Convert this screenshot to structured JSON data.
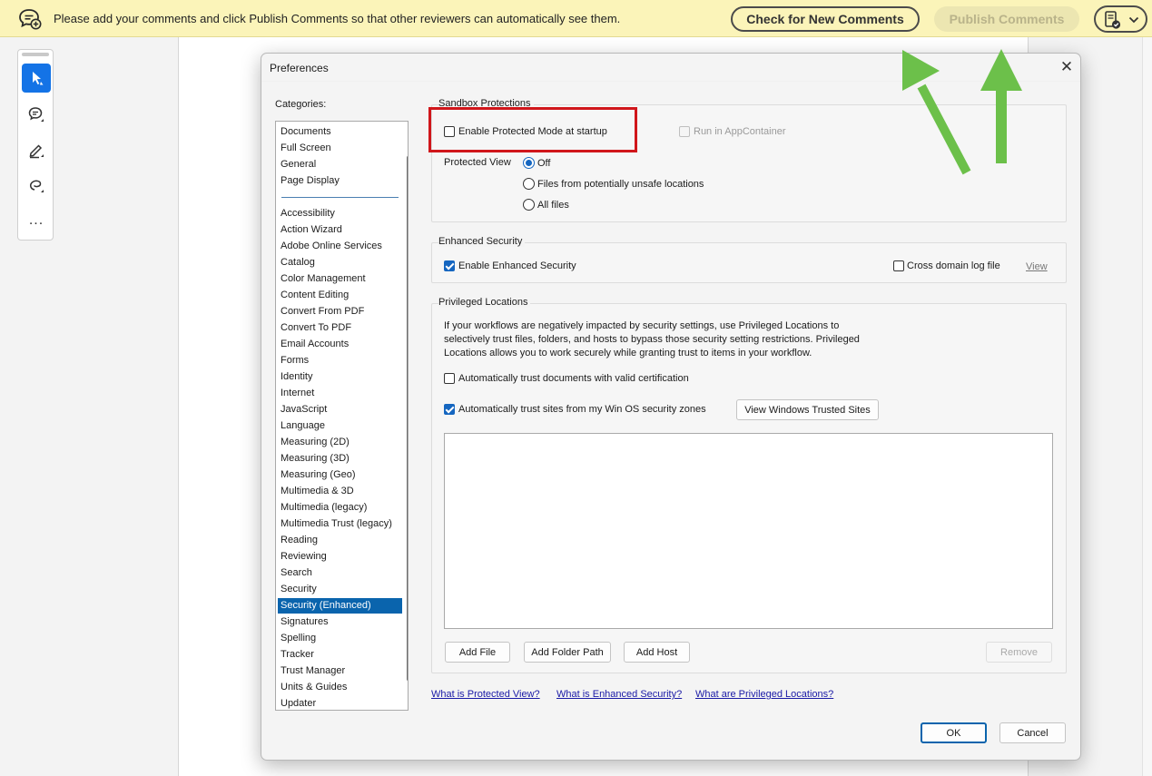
{
  "comment_bar": {
    "message": "Please add your comments and click Publish Comments so that other reviewers can automatically see them.",
    "check_button": "Check for New Comments",
    "publish_button": "Publish Comments"
  },
  "tool_rail": {
    "more_label": "..."
  },
  "dialog": {
    "title": "Preferences",
    "close_glyph": "✕",
    "categories_label": "Categories:",
    "categories": [
      "Documents",
      "Full Screen",
      "General",
      "Page Display",
      "Accessibility",
      "Action Wizard",
      "Adobe Online Services",
      "Catalog",
      "Color Management",
      "Content Editing",
      "Convert From PDF",
      "Convert To PDF",
      "Email Accounts",
      "Forms",
      "Identity",
      "Internet",
      "JavaScript",
      "Language",
      "Measuring (2D)",
      "Measuring (3D)",
      "Measuring (Geo)",
      "Multimedia & 3D",
      "Multimedia (legacy)",
      "Multimedia Trust (legacy)",
      "Reading",
      "Reviewing",
      "Search",
      "Security",
      "Security (Enhanced)",
      "Signatures",
      "Spelling",
      "Tracker",
      "Trust Manager",
      "Units & Guides",
      "Updater"
    ],
    "selected_category": "Security (Enhanced)",
    "sandbox": {
      "title": "Sandbox Protections",
      "protected_mode_label": "Enable Protected Mode at startup",
      "protected_mode_checked": false,
      "appcontainer_label": "Run in AppContainer",
      "protected_view_label": "Protected View",
      "options": [
        "Off",
        "Files from potentially unsafe locations",
        "All files"
      ],
      "selected_option": "Off"
    },
    "enhanced": {
      "title": "Enhanced Security",
      "enable_label": "Enable Enhanced Security",
      "enable_checked": true,
      "cross_domain_label": "Cross domain log file",
      "view_link": "View"
    },
    "privileged": {
      "title": "Privileged Locations",
      "description_line1": "If your workflows are negatively impacted by security settings, use Privileged Locations to",
      "description_line2": "selectively trust files, folders, and hosts to bypass those security setting restrictions. Privileged",
      "description_line3": "Locations allows you to work securely while granting trust to items in your workflow.",
      "trust_cert_label": "Automatically trust documents with valid certification",
      "trust_cert_checked": false,
      "trust_sites_label": "Automatically trust sites from my Win OS security zones",
      "trust_sites_checked": true,
      "view_sites_button": "View Windows Trusted Sites",
      "add_file": "Add File",
      "add_folder": "Add Folder Path",
      "add_host": "Add Host",
      "remove": "Remove"
    },
    "help_links": {
      "protected_view": "What is Protected View?",
      "enhanced_security": "What is Enhanced Security?",
      "privileged_locations": "What are Privileged Locations?"
    },
    "ok_button": "OK",
    "cancel_button": "Cancel"
  },
  "colors": {
    "comment_bar_bg": "#fbf4b9",
    "selection_blue": "#0a64ad",
    "highlight_red": "#d0161b",
    "arrow_green": "#6cc04a"
  }
}
